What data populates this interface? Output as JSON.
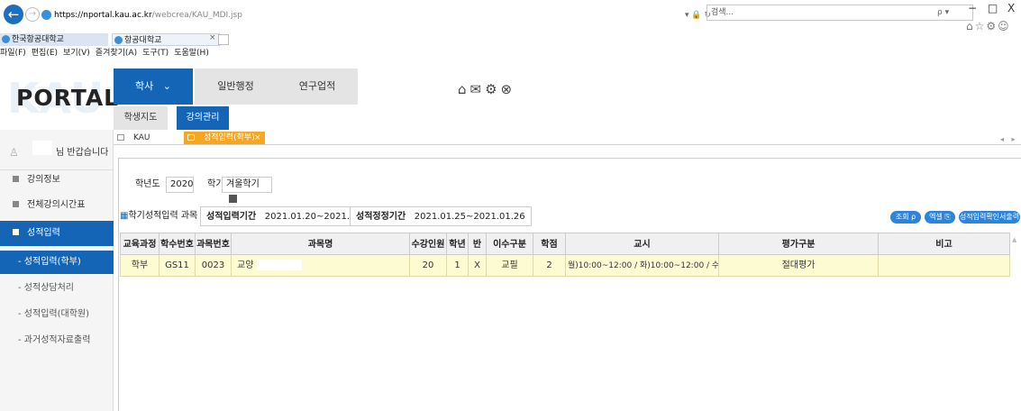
{
  "browser": {
    "url_host": "https://nportal.kau.ac.kr",
    "url_path": "/webcrea/KAU_MDI.jsp",
    "url_tools": "▾ 🔒 ↻",
    "search_placeholder": "검색...",
    "search_tools": "ρ ▾",
    "tabs": [
      {
        "label": "한국항공대학교"
      },
      {
        "label": "항공대학교"
      }
    ],
    "tab_close": "×",
    "menu": [
      "파일(F)",
      "편집(E)",
      "보기(V)",
      "즐겨찾기(A)",
      "도구(T)",
      "도움말(H)"
    ],
    "window_controls": [
      "−",
      "□",
      "X"
    ],
    "right_icons": "⌂☆⚙☺"
  },
  "portal": {
    "logo": "PORTAL",
    "logo_bg": "KAU",
    "nav": [
      "학사",
      "일반행정",
      "연구업적"
    ],
    "nav_haksa_chevron": "⌄",
    "sub_nav": [
      "학생지도",
      "강의관리"
    ],
    "top_icons": "⌂✉⚙⊗"
  },
  "page_tabs": {
    "tab1": "KAU",
    "tab2": "성적입력(학부)",
    "tab2_close": "×",
    "nav_buttons": "◂ ▸"
  },
  "sidebar": {
    "greeting": "님 반갑습니다",
    "menu": [
      {
        "label": "강의정보"
      },
      {
        "label": "전체강의시간표"
      },
      {
        "label": "성적입력"
      }
    ],
    "sub_menu": [
      {
        "label": "성적입력(학부)"
      },
      {
        "label": "성적상담처리"
      },
      {
        "label": "성적입력(대학원)"
      },
      {
        "label": "과거성적자료출력"
      }
    ]
  },
  "filters": {
    "year_label": "학년도",
    "year_value": "2020",
    "term_label": "학기",
    "term_value": "겨울학기"
  },
  "info": {
    "section_title": "학기성적입력 과목",
    "input_period_label": "성적입력기간",
    "input_period_value": "2021.01.20~2021.01.24",
    "fix_period_label": "성적정정기간",
    "fix_period_value": "2021.01.25~2021.01.26",
    "buttons": [
      "조회 ρ",
      "엑셀 ⎘",
      "성적입력확인서출력"
    ]
  },
  "table": {
    "headers": [
      "교육과정",
      "학수번호",
      "과목번호",
      "과목명",
      "수강인원",
      "학년",
      "반",
      "이수구분",
      "학점",
      "교시",
      "평가구분",
      "비고"
    ],
    "rows": [
      [
        "학부",
        "GS11",
        "0023",
        "교양",
        "20",
        "1",
        "X",
        "교필",
        "2",
        "월)10:00~12:00 / 화)10:00~12:00 / 수)10:00~",
        "절대평가",
        ""
      ]
    ]
  },
  "colors": {
    "primary": "#1565b7",
    "tab_active": "#f5a623",
    "row_highlight": "#fdfbd1"
  }
}
